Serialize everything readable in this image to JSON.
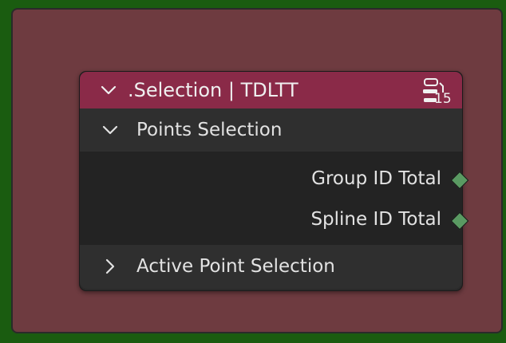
{
  "node": {
    "title": ".Selection | TDLTT",
    "user_count": "15",
    "header_color": "#8a2a48",
    "icons": {
      "collapse": "chevron-down-icon",
      "users": "node-group-users-icon"
    }
  },
  "panels": {
    "points": {
      "label": "Points Selection",
      "expanded": true,
      "outputs": [
        {
          "label": "Group ID Total",
          "socket_color": "#5a9a62"
        },
        {
          "label": "Spline ID Total",
          "socket_color": "#5a9a62"
        }
      ]
    },
    "active": {
      "label": "Active Point Selection",
      "expanded": false
    }
  },
  "colors": {
    "frame": "#6e3b40",
    "background": "#1a5c10"
  }
}
